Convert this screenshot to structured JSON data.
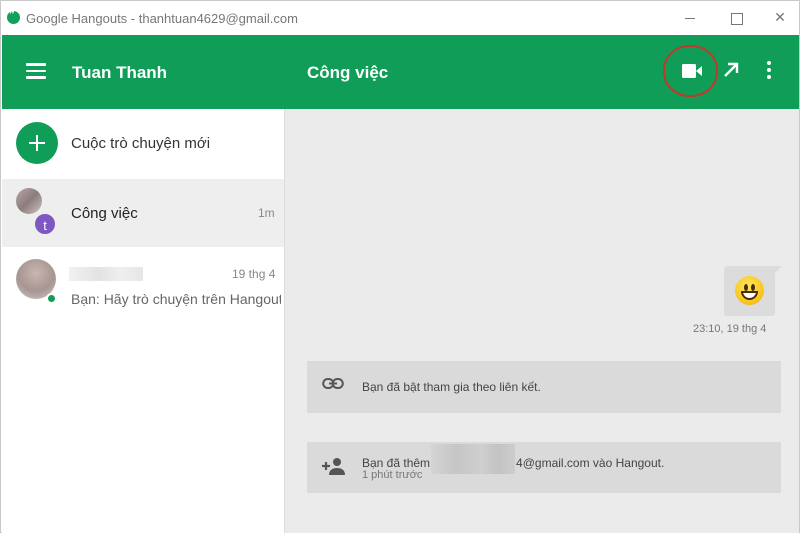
{
  "window": {
    "title": "Google Hangouts - thanhtuan4629@gmail.com",
    "controls": {
      "minimize": "minimize",
      "maximize": "maximize",
      "close": "✕"
    }
  },
  "appbar": {
    "user_name": "Tuan Thanh",
    "conversation_title": "Công việc",
    "accent": "#0f9d58",
    "icons": [
      "menu-icon",
      "video-call-icon",
      "popout-icon",
      "more-vert-icon"
    ]
  },
  "sidebar": {
    "new_conversation_label": "Cuộc trò chuyện mới",
    "conversations": [
      {
        "name": "Công việc",
        "time": "1m",
        "avatar_letter": "t",
        "avatar_color": "#7e57c2"
      },
      {
        "name": "",
        "date": "19 thg 4",
        "snippet": "Bạn: Hãy trò chuyện trên Hangout",
        "status_color": "#0f9d58"
      }
    ]
  },
  "chat": {
    "message_time": "23:10, 19 thg 4",
    "system_messages": [
      {
        "icon": "link-icon",
        "text": "Bạn đã bật tham gia theo liên kết."
      },
      {
        "icon": "person-add-icon",
        "text_before": "Bạn đã thêm",
        "text_after": "4@gmail.com vào Hangout.",
        "sub": "1 phút trước"
      }
    ]
  }
}
